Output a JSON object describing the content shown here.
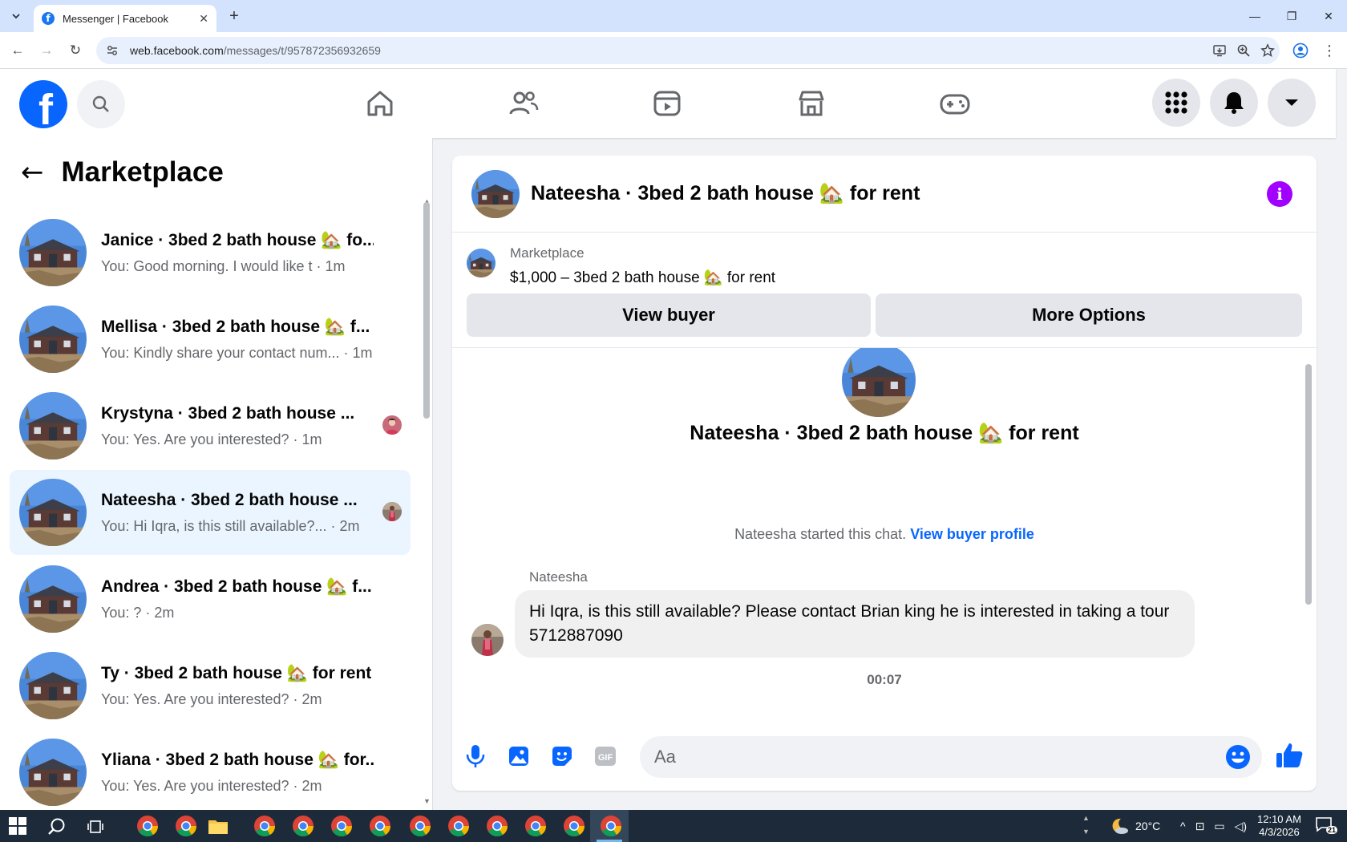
{
  "browser": {
    "tab_title": "Messenger | Facebook",
    "url_domain": "web.facebook.com",
    "url_path": "/messages/t/957872356932659"
  },
  "fbnav": {
    "logo_letter": "f"
  },
  "sidebar": {
    "title": "Marketplace",
    "conversations": [
      {
        "name": "Janice · 3bed 2 bath house 🏡 fo...",
        "snippet": "You: Good morning. I would like t · 1m",
        "active": false
      },
      {
        "name": "Mellisa · 3bed 2 bath house 🏡 f...",
        "snippet": "You: Kindly share your contact num... · 1m",
        "active": false
      },
      {
        "name": "Krystyna · 3bed 2 bath house ...",
        "snippet": "You: Yes. Are you interested? · 1m",
        "active": false
      },
      {
        "name": "Nateesha · 3bed 2 bath house ...",
        "snippet": "You: Hi Iqra, is this still available?... · 2m",
        "active": true
      },
      {
        "name": "Andrea · 3bed 2 bath house 🏡 f...",
        "snippet": "You: ? · 2m",
        "active": false
      },
      {
        "name": "Ty · 3bed 2 bath house 🏡 for rent",
        "snippet": "You: Yes. Are you interested? · 2m",
        "active": false
      },
      {
        "name": "Yliana · 3bed 2 bath house 🏡 for...",
        "snippet": "You: Yes. Are you interested? · 2m",
        "active": false
      }
    ]
  },
  "chat": {
    "header_title": "Nateesha · 3bed 2 bath house 🏡 for rent",
    "listing_category": "Marketplace",
    "listing_price": "$1,000 – 3bed 2 bath house 🏡 for rent",
    "view_buyer_label": "View buyer",
    "more_options_label": "More Options",
    "intro_title": "Nateesha · 3bed 2 bath house 🏡 for rent",
    "started_text": "Nateesha started this chat.",
    "view_profile_link": "View buyer profile",
    "sender_name": "Nateesha",
    "message_text": "Hi Iqra, is this still available? Please contact Brian king he is interested in taking a tour 5712887090",
    "timestamp": "00:07",
    "input_placeholder": "Aa"
  },
  "taskbar": {
    "weather": "20°C",
    "time": "12:10 AM",
    "date": "4/3/2026",
    "notif_count": "21"
  },
  "colors": {
    "fb_blue": "#0866ff",
    "info_purple": "#a100ff",
    "active_row": "#ebf5ff"
  }
}
